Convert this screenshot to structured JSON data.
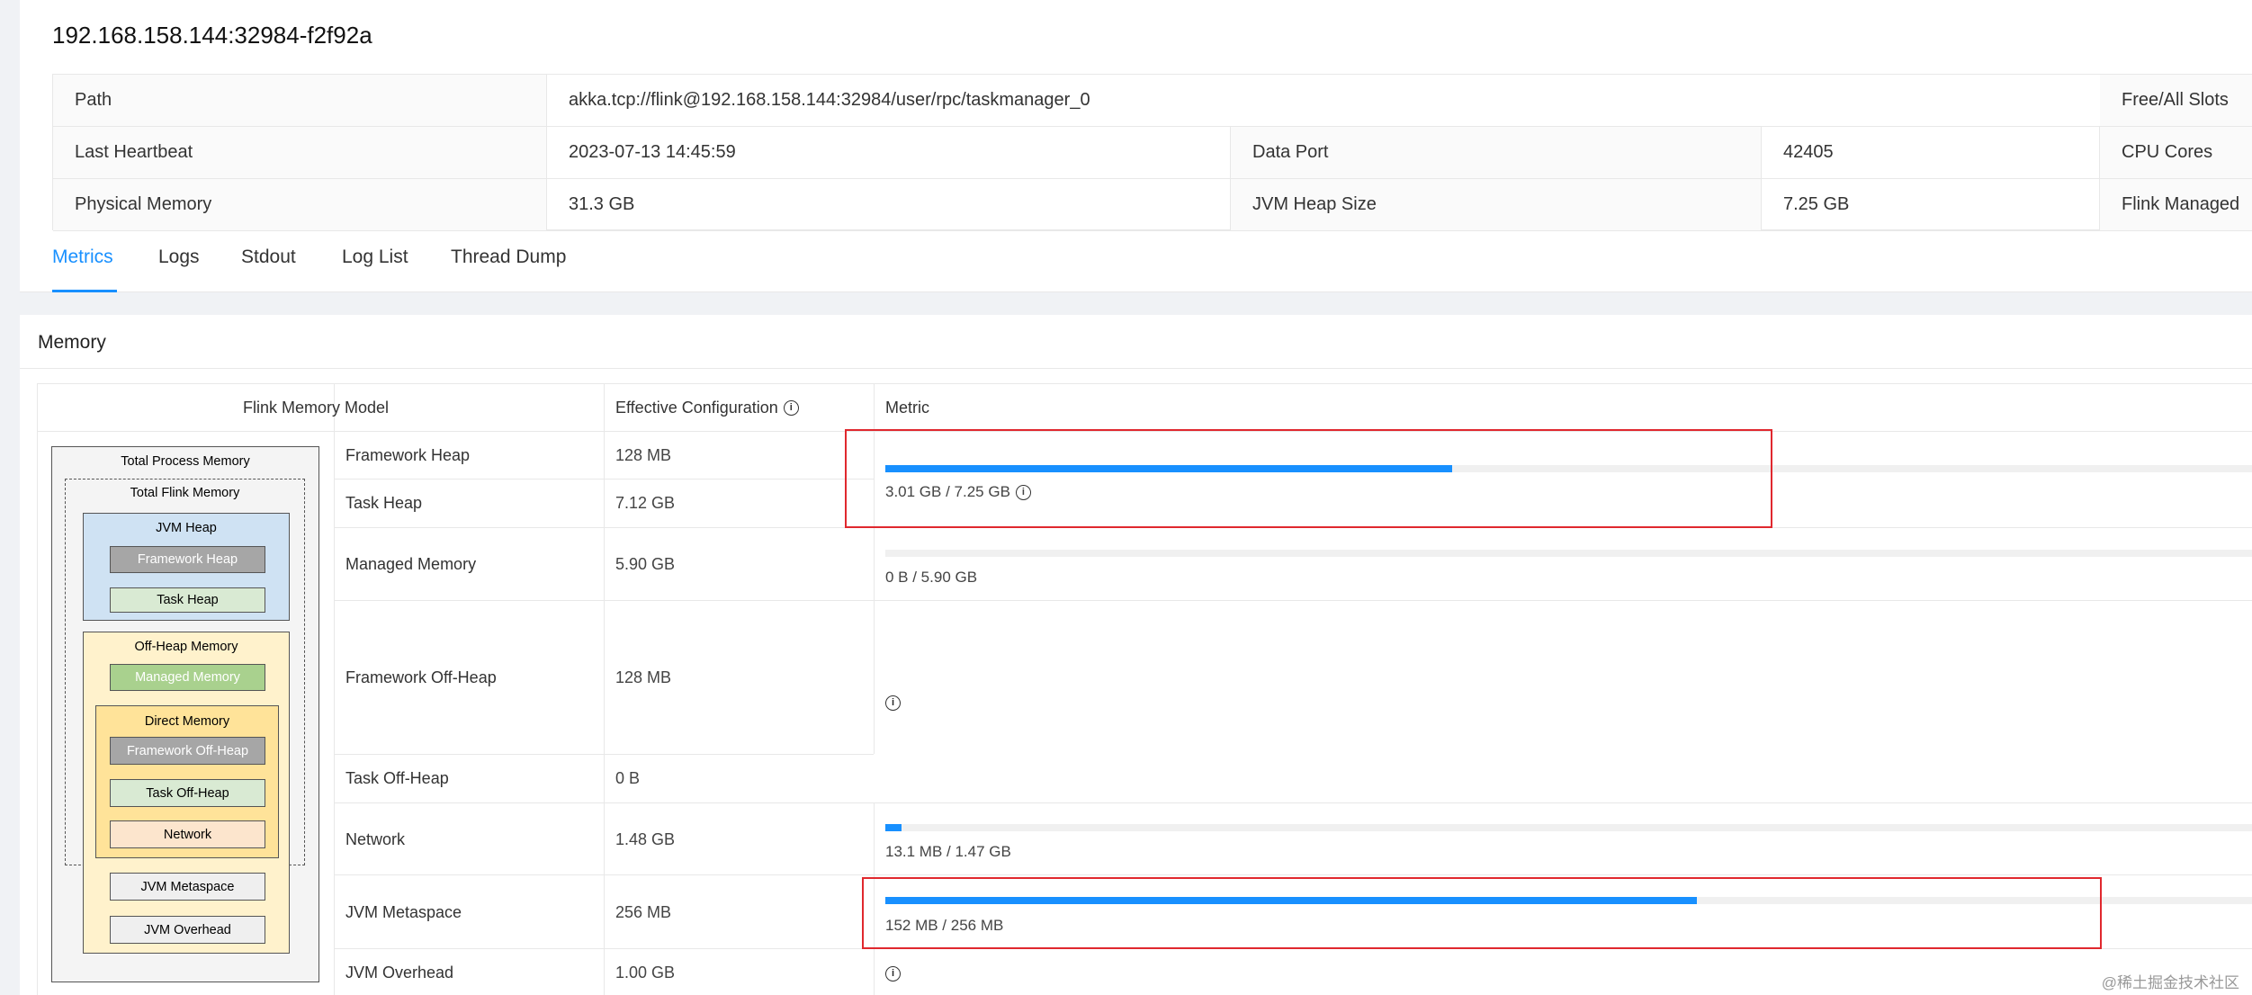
{
  "taskmanager": {
    "title": "192.168.158.144:32984-f2f92a"
  },
  "info": {
    "path_label": "Path",
    "path_value": "akka.tcp://flink@192.168.158.144:32984/user/rpc/taskmanager_0",
    "slots_label": "Free/All Slots",
    "heartbeat_label": "Last Heartbeat",
    "heartbeat_value": "2023-07-13 14:45:59",
    "dataport_label": "Data Port",
    "dataport_value": "42405",
    "cpu_label": "CPU Cores",
    "physmem_label": "Physical Memory",
    "physmem_value": "31.3 GB",
    "jvmheap_label": "JVM Heap Size",
    "jvmheap_value": "7.25 GB",
    "flinkmanaged_label": "Flink Managed"
  },
  "tabs": [
    {
      "label": "Metrics",
      "active": true
    },
    {
      "label": "Logs",
      "active": false
    },
    {
      "label": "Stdout",
      "active": false
    },
    {
      "label": "Log List",
      "active": false
    },
    {
      "label": "Thread Dump",
      "active": false
    }
  ],
  "memory": {
    "title": "Memory",
    "headers": {
      "model": "Flink Memory Model",
      "config": "Effective Configuration",
      "metric": "Metric"
    },
    "rows": [
      {
        "label": "Framework Heap",
        "value": "128 MB"
      },
      {
        "label": "Task Heap",
        "value": "7.12 GB"
      },
      {
        "label": "Managed Memory",
        "value": "5.90 GB"
      },
      {
        "label": "Framework Off-Heap",
        "value": "128 MB"
      },
      {
        "label": "Task Off-Heap",
        "value": "0 B"
      },
      {
        "label": "Network",
        "value": "1.48 GB"
      },
      {
        "label": "JVM Metaspace",
        "value": "256 MB"
      },
      {
        "label": "JVM Overhead",
        "value": "1.00 GB"
      }
    ],
    "metrics": {
      "heap": {
        "text": "3.01 GB / 7.25 GB",
        "fraction": 0.415
      },
      "managed": {
        "text": "0 B / 5.90 GB",
        "fraction": 0.0
      },
      "network": {
        "text": "13.1 MB / 1.47 GB",
        "fraction": 0.009
      },
      "metaspace": {
        "text": "152 MB / 256 MB",
        "fraction": 0.594
      }
    }
  },
  "diagram": {
    "total_process": "Total Process Memory",
    "total_flink": "Total Flink Memory",
    "jvm_heap": "JVM Heap",
    "framework_heap": "Framework Heap",
    "task_heap": "Task Heap",
    "off_heap": "Off-Heap Memory",
    "managed_memory": "Managed Memory",
    "direct_memory": "Direct Memory",
    "framework_off_heap": "Framework Off-Heap",
    "task_off_heap": "Task Off-Heap",
    "network": "Network",
    "jvm_metaspace": "JVM Metaspace",
    "jvm_overhead": "JVM Overhead"
  },
  "colors": {
    "accent": "#1890ff",
    "highlight": "#e0282e"
  },
  "watermark": "@稀土掘金技术社区"
}
